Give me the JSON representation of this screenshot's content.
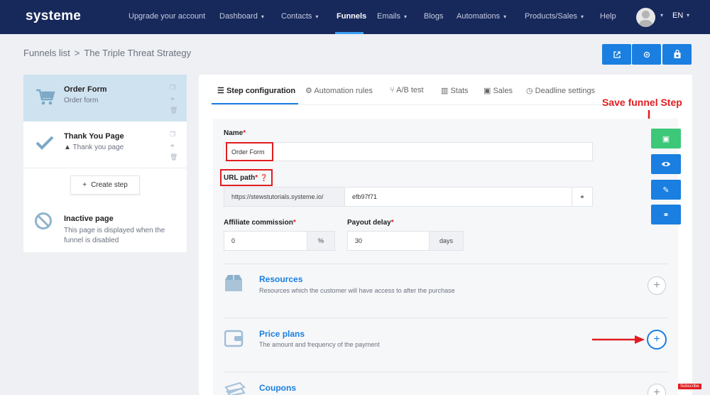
{
  "brand": "systeme",
  "nav": {
    "items": [
      {
        "label": "Upgrade your account",
        "chevron": false
      },
      {
        "label": "Dashboard",
        "chevron": true
      },
      {
        "label": "Contacts",
        "chevron": true
      },
      {
        "label": "Funnels",
        "chevron": false,
        "active": true
      },
      {
        "label": "Emails",
        "chevron": true
      },
      {
        "label": "Blogs",
        "chevron": false
      },
      {
        "label": "Automations",
        "chevron": true
      },
      {
        "label": "Products/Sales",
        "chevron": true
      },
      {
        "label": "Help",
        "chevron": false
      }
    ],
    "language": "EN"
  },
  "breadcrumb": {
    "parent": "Funnels list",
    "separator": ">",
    "current": "The Triple Threat Strategy"
  },
  "top_actions": [
    {
      "icon": "external-link-icon",
      "glyph": "↗"
    },
    {
      "icon": "settings-gear-icon",
      "glyph": "⚙"
    },
    {
      "icon": "store-icon",
      "glyph": "⌂"
    }
  ],
  "steps": [
    {
      "title": "Order Form",
      "subtitle": "Order form",
      "icon": "cart-icon",
      "active": true
    },
    {
      "title": "Thank You Page",
      "subtitle": "Thank you page",
      "icon": "check-icon",
      "warning": true
    }
  ],
  "create_step_label": "Create step",
  "inactive_page": {
    "title": "Inactive page",
    "subtitle": "This page is displayed when the funnel is disabled"
  },
  "tabs": [
    {
      "label": "Step configuration",
      "icon": "list-icon",
      "glyph": "☰",
      "active": true
    },
    {
      "label": "Automation rules",
      "icon": "cogs-icon",
      "glyph": "⚙"
    },
    {
      "label": "A/B test",
      "icon": "split-icon",
      "glyph": "⑂"
    },
    {
      "label": "Stats",
      "icon": "bar-chart-icon",
      "glyph": "▥"
    },
    {
      "label": "Sales",
      "icon": "money-icon",
      "glyph": "▣"
    },
    {
      "label": "Deadline settings",
      "icon": "clock-icon",
      "glyph": "◷"
    }
  ],
  "annotation": "Save funnel Step",
  "form": {
    "name_label": "Name",
    "name_value": "Order Form",
    "url_label": "URL path",
    "url_prefix": "https://stewstutorials.systeme.io/",
    "url_value": "efb97f71",
    "affiliate_label": "Affiliate commission",
    "affiliate_value": "0",
    "affiliate_unit": "%",
    "payout_label": "Payout delay",
    "payout_value": "30",
    "payout_unit": "days"
  },
  "sections": [
    {
      "title": "Resources",
      "subtitle": "Resources which the customer will have access to after the purchase",
      "icon": "box-icon"
    },
    {
      "title": "Price plans",
      "subtitle": "The amount and frequency of the payment",
      "icon": "wallet-icon"
    },
    {
      "title": "Coupons",
      "subtitle": "",
      "icon": "coupon-icon"
    }
  ],
  "subscribe_badge": "Subscribe",
  "colors": {
    "nav_bg": "#17285b",
    "primary": "#1a7fe0",
    "save_green": "#3dc779",
    "annotation_red": "#e11d21",
    "active_step_bg": "#cfe2ef"
  }
}
